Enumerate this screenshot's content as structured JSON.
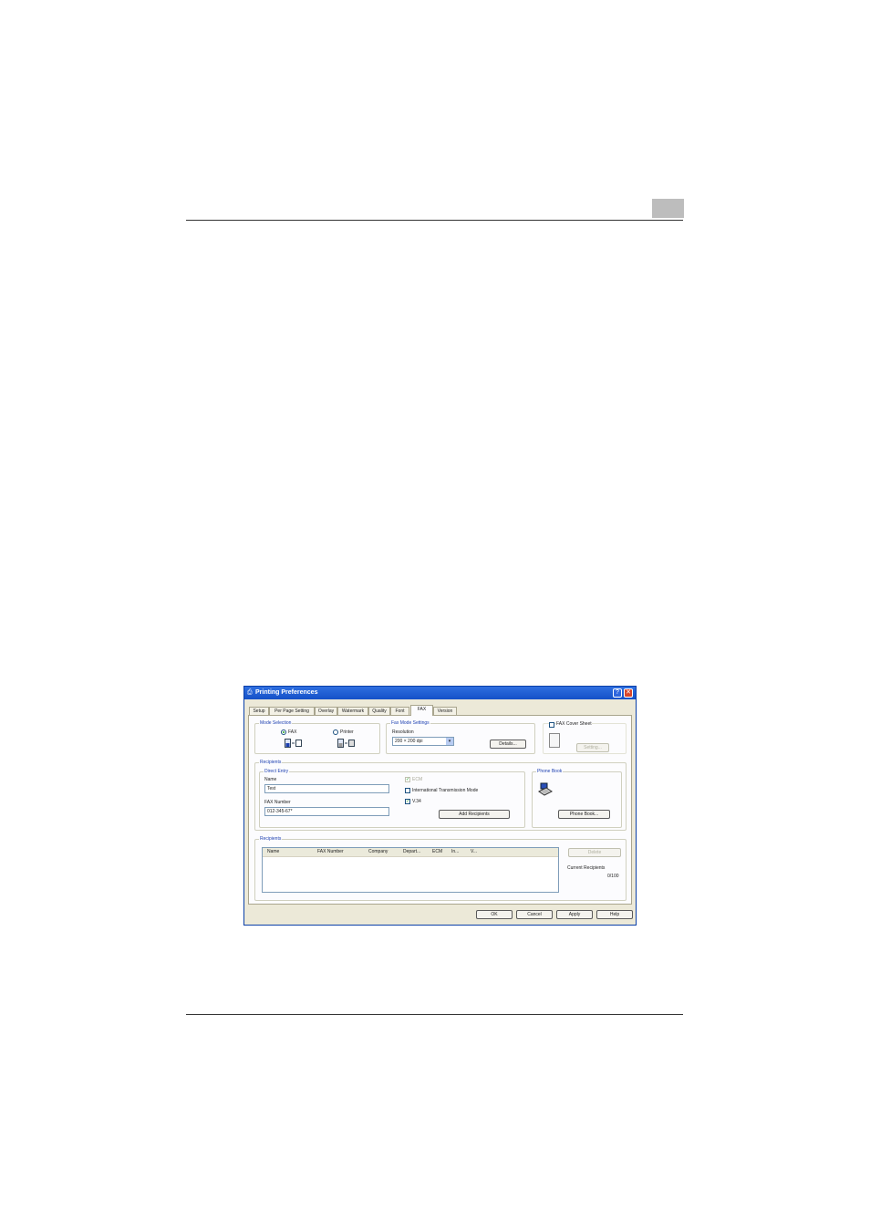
{
  "dialog": {
    "title": "Printing Preferences",
    "help_btn": "?",
    "close_btn": "✕",
    "tabs": [
      "Setup",
      "Per Page Setting",
      "Overlay",
      "Watermark",
      "Quality",
      "Font",
      "FAX",
      "Version"
    ],
    "mode_selection": {
      "legend": "Mode Selection",
      "fax_label": "FAX",
      "printer_label": "Printer"
    },
    "fax_mode_settings": {
      "legend": "Fax Mode Settings",
      "resolution_label": "Resolution",
      "resolution_value": "200 × 200 dpi",
      "details_btn": "Details..."
    },
    "cover_sheet": {
      "label": "FAX Cover Sheet",
      "setting_btn": "Setting..."
    },
    "recipients_group": {
      "legend": "Recipients",
      "direct_entry_legend": "Direct Entry",
      "name_label": "Name",
      "name_value": "Test",
      "fax_number_label": "FAX Number",
      "fax_number_value": "012-345-67*",
      "ecm_label": "ECM",
      "itm_label": "International Transmission Mode",
      "v34_label": "V.34",
      "add_btn": "Add Recipients"
    },
    "phone_book": {
      "legend": "Phone Book",
      "btn": "Phone Book..."
    },
    "recipients_list": {
      "legend": "Recipients",
      "columns": [
        "Name",
        "FAX Number",
        "Company",
        "Depart...",
        "ECM",
        "In...",
        "V..."
      ],
      "delete_btn": "Delete",
      "current_label": "Current Recipients",
      "count": "0/100"
    },
    "footer": {
      "ok": "OK",
      "cancel": "Cancel",
      "apply": "Apply",
      "help": "Help"
    }
  }
}
